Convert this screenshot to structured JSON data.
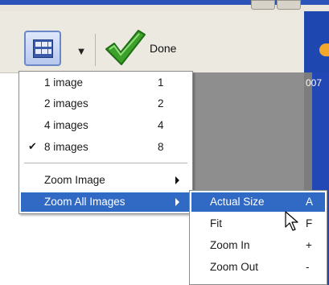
{
  "toolbar": {
    "layout_icon": "image-grid-icon",
    "dropdown_icon": "chevron-down-icon",
    "done_icon": "checkmark-icon",
    "done_label": "Done"
  },
  "background": {
    "partial_text": "007"
  },
  "menu": {
    "items": [
      {
        "label": "1 image",
        "key": "1",
        "checked": false
      },
      {
        "label": "2 images",
        "key": "2",
        "checked": false
      },
      {
        "label": "4 images",
        "key": "4",
        "checked": false
      },
      {
        "label": "8 images",
        "key": "8",
        "checked": true,
        "check_mark": "✔"
      },
      {
        "label": "Zoom Image",
        "has_submenu": true
      },
      {
        "label": "Zoom All Images",
        "has_submenu": true,
        "highlighted": true
      }
    ]
  },
  "submenu": {
    "items": [
      {
        "label": "Actual Size",
        "key": "A",
        "highlighted": true
      },
      {
        "label": "Fit",
        "key": "F"
      },
      {
        "label": "Zoom In",
        "key": "+"
      },
      {
        "label": "Zoom Out",
        "key": "-"
      }
    ]
  },
  "colors": {
    "highlight": "#316ac5",
    "menu_bg": "#ffffff",
    "toolbar_bg": "#ece9e1",
    "check_green": "#3ca12a"
  }
}
